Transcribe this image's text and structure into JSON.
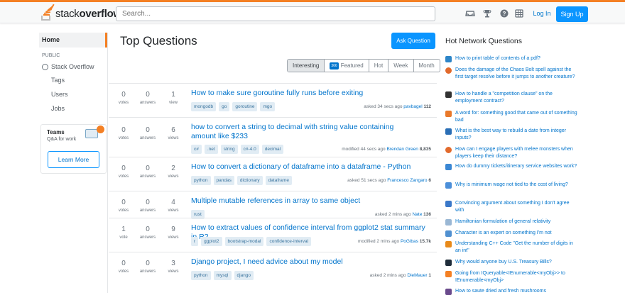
{
  "header": {
    "logo_light": "stack",
    "logo_bold": "overflow",
    "search_placeholder": "Search...",
    "login_label": "Log In",
    "signup_label": "Sign Up"
  },
  "leftnav": {
    "home": "Home",
    "public": "PUBLIC",
    "stackoverflow": "Stack Overflow",
    "tags": "Tags",
    "users": "Users",
    "jobs": "Jobs",
    "teams_title": "Teams",
    "teams_sub": "Q&A for work",
    "teams_button": "Learn More"
  },
  "main": {
    "title": "Top Questions",
    "ask_button": "Ask Question",
    "tabs": [
      "Interesting",
      "Featured",
      "Hot",
      "Week",
      "Month"
    ],
    "featured_badge": "366",
    "questions": [
      {
        "votes": "0",
        "votes_label": "votes",
        "answers": "0",
        "answers_label": "answers",
        "views": "1",
        "views_label": "view",
        "title": "How to make sure goroutine fully runs before exiting",
        "tags": [
          "mongodb",
          "go",
          "goroutine",
          "mgo"
        ],
        "action": "asked 34 secs ago",
        "user": "pavbagel",
        "rep": "112"
      },
      {
        "votes": "0",
        "votes_label": "votes",
        "answers": "0",
        "answers_label": "answers",
        "views": "6",
        "views_label": "views",
        "title": "how to convert a string to decimal with string value containing amount like $233",
        "tags": [
          "c#",
          ".net",
          "string",
          "c#-4.0",
          "decimal"
        ],
        "action": "modified 44 secs ago",
        "user": "Brendan Green",
        "rep": "8,835"
      },
      {
        "votes": "0",
        "votes_label": "votes",
        "answers": "0",
        "answers_label": "answers",
        "views": "2",
        "views_label": "views",
        "title": "How to convert a dictionary of dataframe into a dataframe - Python",
        "tags": [
          "python",
          "pandas",
          "dictionary",
          "dataframe"
        ],
        "action": "asked 51 secs ago",
        "user": "Francesco Zangaro",
        "rep": "6"
      },
      {
        "votes": "0",
        "votes_label": "votes",
        "answers": "0",
        "answers_label": "answers",
        "views": "4",
        "views_label": "views",
        "title": "Multiple mutable references in array to same object",
        "tags": [
          "rust"
        ],
        "action": "asked 2 mins ago",
        "user": "Nate",
        "rep": "136"
      },
      {
        "votes": "1",
        "votes_label": "vote",
        "answers": "0",
        "answers_label": "answers",
        "views": "9",
        "views_label": "views",
        "title": "How to extract values of confidence interval from ggplot2 stat summary in R?",
        "tags": [
          "r",
          "ggplot2",
          "bootstrap-modal",
          "confidence-interval"
        ],
        "action": "modified 2 mins ago",
        "user": "PoGibas",
        "rep": "15.7k"
      },
      {
        "votes": "0",
        "votes_label": "votes",
        "answers": "0",
        "answers_label": "answers",
        "views": "3",
        "views_label": "views",
        "title": "Django project, I need advice about my model",
        "tags": [
          "python",
          "mysql",
          "django"
        ],
        "action": "asked 2 mins ago",
        "user": "DieMauer",
        "rep": "1"
      }
    ]
  },
  "sidebar": {
    "title": "Hot Network Questions",
    "items": [
      {
        "text": "How to print table of contents of a pdf?",
        "icon": "superuser-icon",
        "color": "#2d85c8"
      },
      {
        "text": "Does the damage of the Chaos Bolt spell against the first target resolve before it jumps to another creature?",
        "icon": "rpg-icon",
        "color": "#e26a2c"
      },
      {
        "text": "How to handle a \"competition clause\" on the employment contract?",
        "icon": "workplace-icon",
        "color": "#323232"
      },
      {
        "text": "A word for: something good that came out of something bad",
        "icon": "english-icon",
        "color": "#e9792a"
      },
      {
        "text": "What is the best way to rebuild a date from integer inputs?",
        "icon": "dba-icon",
        "color": "#2a6eb5"
      },
      {
        "text": "How can I engage players with melee monsters when players keep their distance?",
        "icon": "rpg-icon",
        "color": "#e26a2c"
      },
      {
        "text": "How do dummy tickets/itinerary service websites work?",
        "icon": "travel-icon",
        "color": "#3a87d4"
      },
      {
        "text": "Why is minimum wage not tied to the cost of living?",
        "icon": "economics-icon",
        "color": "#4b8fd9"
      },
      {
        "text": "Convincing argument about something I don't agree with",
        "icon": "interpersonal-icon",
        "color": "#3a78c9"
      },
      {
        "text": "Hamiltonian formulation of general relativity",
        "icon": "physics-icon",
        "color": "#9ab7d4"
      },
      {
        "text": "Character is an expert on something I'm not",
        "icon": "writing-icon",
        "color": "#5090d0"
      },
      {
        "text": "Understanding C++ Code \"Get the number of digits in an int\"",
        "icon": "codereview-icon",
        "color": "#e88a1a"
      },
      {
        "text": "Why would anyone buy U.S. Treasury Bills?",
        "icon": "money-icon",
        "color": "#1f2d3a"
      },
      {
        "text": "Going from IQueryable<IEnumerable<myObj>> to IEnumerable<myObj>",
        "icon": "stackoverflow-icon",
        "color": "#f48024"
      },
      {
        "text": "How to saute dried and fresh mushrooms",
        "icon": "cooking-icon",
        "color": "#6a4a8c"
      }
    ]
  }
}
